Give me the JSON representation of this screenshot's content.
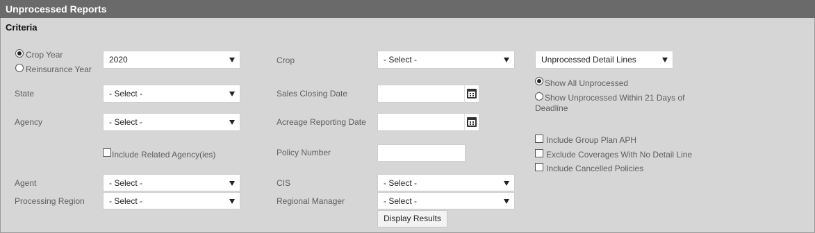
{
  "title": "Unprocessed Reports",
  "section_heading": "Criteria",
  "year_type": {
    "options": [
      "Crop Year",
      "Reinsurance Year"
    ],
    "selected": "Crop Year",
    "year_value": "2020"
  },
  "fields": {
    "crop": {
      "label": "Crop",
      "value": "- Select -"
    },
    "report_type": {
      "value": "Unprocessed Detail Lines"
    },
    "state": {
      "label": "State",
      "value": "- Select -"
    },
    "sales_closing_date": {
      "label": "Sales Closing Date",
      "value": ""
    },
    "agency": {
      "label": "Agency",
      "value": "- Select -"
    },
    "acreage_reporting_date": {
      "label": "Acreage Reporting Date",
      "value": ""
    },
    "include_related_agency": {
      "label": "Include Related Agency(ies)",
      "checked": false
    },
    "policy_number": {
      "label": "Policy Number",
      "value": ""
    },
    "agent": {
      "label": "Agent",
      "value": "- Select -"
    },
    "cis": {
      "label": "CIS",
      "value": "- Select -"
    },
    "processing_region": {
      "label": "Processing Region",
      "value": "- Select -"
    },
    "regional_manager": {
      "label": "Regional Manager",
      "value": "- Select -"
    }
  },
  "show_options": {
    "all": "Show All Unprocessed",
    "within_line1": "Show Unprocessed Within 21 Days of",
    "within_line2": "Deadline",
    "selected": "all"
  },
  "checkboxes": {
    "group_plan": {
      "label": "Include Group Plan APH",
      "checked": false
    },
    "exclude_no_detail": {
      "label": "Exclude Coverages With No Detail Line",
      "checked": false
    },
    "cancelled": {
      "label": "Include Cancelled Policies",
      "checked": false
    }
  },
  "actions": {
    "display_results": "Display Results"
  },
  "icons": {
    "date_picker": "calendar-icon",
    "dropdown": "chevron-down-icon"
  }
}
